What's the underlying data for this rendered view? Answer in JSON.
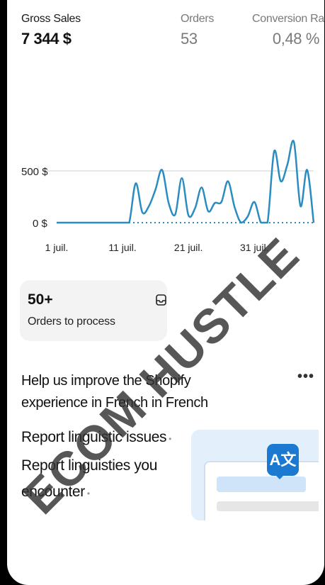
{
  "metrics": [
    {
      "label": "Gross Sales",
      "value": "7 344 $"
    },
    {
      "label": "Orders",
      "value": "53"
    },
    {
      "label": "Conversion Rate",
      "value": "0,48 %"
    }
  ],
  "chart_data": {
    "type": "line",
    "x": [
      1,
      2,
      3,
      4,
      5,
      6,
      7,
      8,
      9,
      10,
      11,
      12,
      13,
      14,
      15,
      16,
      17,
      18,
      19,
      20,
      21,
      22,
      23,
      24,
      25,
      26,
      27,
      28,
      29,
      30,
      31,
      32,
      33,
      34,
      35,
      36,
      37,
      38,
      39,
      40
    ],
    "series": [
      {
        "values": [
          0,
          0,
          0,
          0,
          0,
          0,
          0,
          0,
          0,
          0,
          0,
          0,
          380,
          100,
          160,
          320,
          510,
          190,
          80,
          430,
          70,
          140,
          340,
          110,
          190,
          200,
          400,
          150,
          0,
          60,
          200,
          0,
          0,
          690,
          400,
          560,
          780,
          160,
          510,
          0
        ]
      }
    ],
    "y_ticks": [
      "500 $",
      "0 $"
    ],
    "x_ticks": [
      "1 juil.",
      "11 juil.",
      "21 juil.",
      "31 juil."
    ],
    "ylim": [
      0,
      850
    ],
    "grid": true,
    "line_color": "#2a8cbf",
    "baseline_dotted": true
  },
  "orders_card": {
    "count": "50+",
    "label": "Orders to process",
    "icon": "inbox-icon"
  },
  "help": {
    "title": "Help us improve the Shopify experience in French in French",
    "more": "•••"
  },
  "links": [
    {
      "text": "Report linguistic issues"
    },
    {
      "text": "Report linguisties you encounter"
    }
  ],
  "illustration": {
    "badge": "A文"
  },
  "watermark": "ECOM HUSTLE"
}
